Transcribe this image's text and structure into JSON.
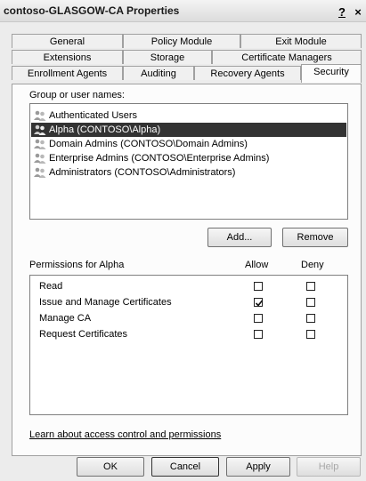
{
  "window": {
    "title": "contoso-GLASGOW-CA Properties",
    "help_glyph": "?",
    "close_glyph": "×"
  },
  "tabs": {
    "row1": [
      "General",
      "Policy Module",
      "Exit Module"
    ],
    "row2": [
      "Extensions",
      "Storage",
      "Certificate Managers"
    ],
    "row3": [
      "Enrollment Agents",
      "Auditing",
      "Recovery Agents",
      "Security"
    ],
    "active": "Security"
  },
  "security": {
    "group_label": "Group or user names:",
    "users": [
      "Authenticated Users",
      "Alpha (CONTOSO\\Alpha)",
      "Domain Admins (CONTOSO\\Domain Admins)",
      "Enterprise Admins (CONTOSO\\Enterprise Admins)",
      "Administrators (CONTOSO\\Administrators)"
    ],
    "selected_user_index": 1,
    "add_label": "Add...",
    "remove_label": "Remove",
    "permissions_label": "Permissions for Alpha",
    "allow_header": "Allow",
    "deny_header": "Deny",
    "permissions": [
      {
        "name": "Read",
        "allow": false,
        "deny": false
      },
      {
        "name": "Issue and Manage Certificates",
        "allow": true,
        "deny": false
      },
      {
        "name": "Manage CA",
        "allow": false,
        "deny": false
      },
      {
        "name": "Request Certificates",
        "allow": false,
        "deny": false
      }
    ],
    "learn_link": "Learn about access control and permissions"
  },
  "buttons": {
    "ok": "OK",
    "cancel": "Cancel",
    "apply": "Apply",
    "help": "Help"
  },
  "icons": {
    "user_group": "users-icon",
    "checkmark": "check-icon"
  }
}
